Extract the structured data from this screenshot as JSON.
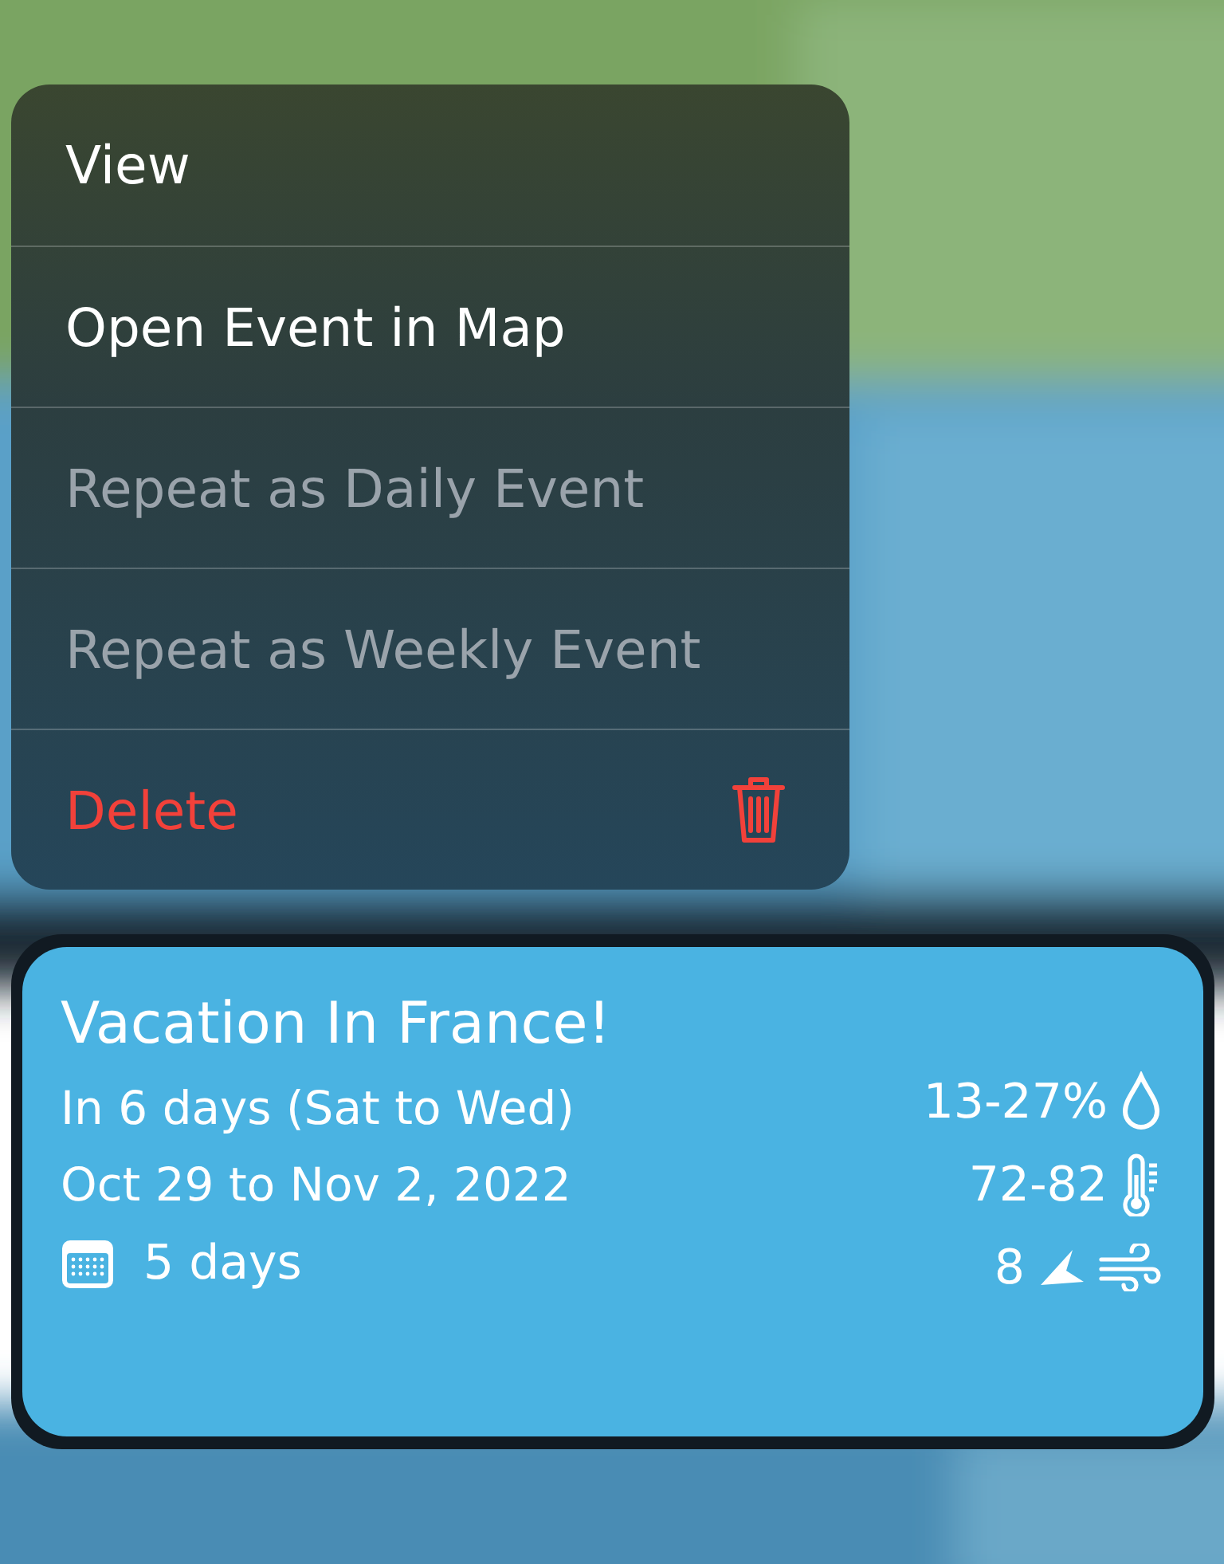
{
  "menu": {
    "items": [
      {
        "label": "View",
        "kind": "default",
        "disabled": false
      },
      {
        "label": "Open Event in Map",
        "kind": "default",
        "disabled": false
      },
      {
        "label": "Repeat as Daily Event",
        "kind": "default",
        "disabled": true
      },
      {
        "label": "Repeat as Weekly Event",
        "kind": "default",
        "disabled": true
      },
      {
        "label": "Delete",
        "kind": "destructive",
        "disabled": false
      }
    ]
  },
  "event": {
    "title": "Vacation In France!",
    "relative": "In 6 days (Sat to Wed)",
    "dates": "Oct 29 to Nov 2, 2022",
    "duration": "5 days",
    "weather": [
      {
        "kind": "rain",
        "text": "13-27%"
      },
      {
        "kind": "temperature",
        "text": "72-82"
      },
      {
        "kind": "wind",
        "text": "8"
      }
    ]
  }
}
